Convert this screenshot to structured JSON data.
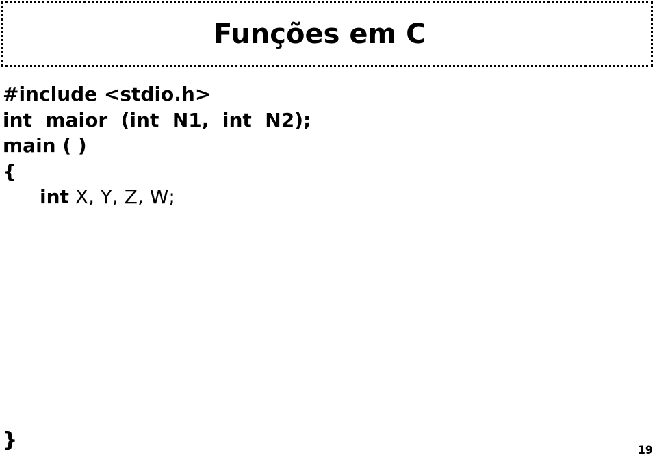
{
  "slide": {
    "title": "Funções em C",
    "code_lines": [
      "#include <stdio.h>",
      "int  maior  (int  N1,  int  N2);",
      "main ( )",
      "{"
    ],
    "declaration": {
      "keyword": "int",
      "variables": " X, Y, Z, W;"
    },
    "closing_brace": "}",
    "page_number": "19"
  }
}
